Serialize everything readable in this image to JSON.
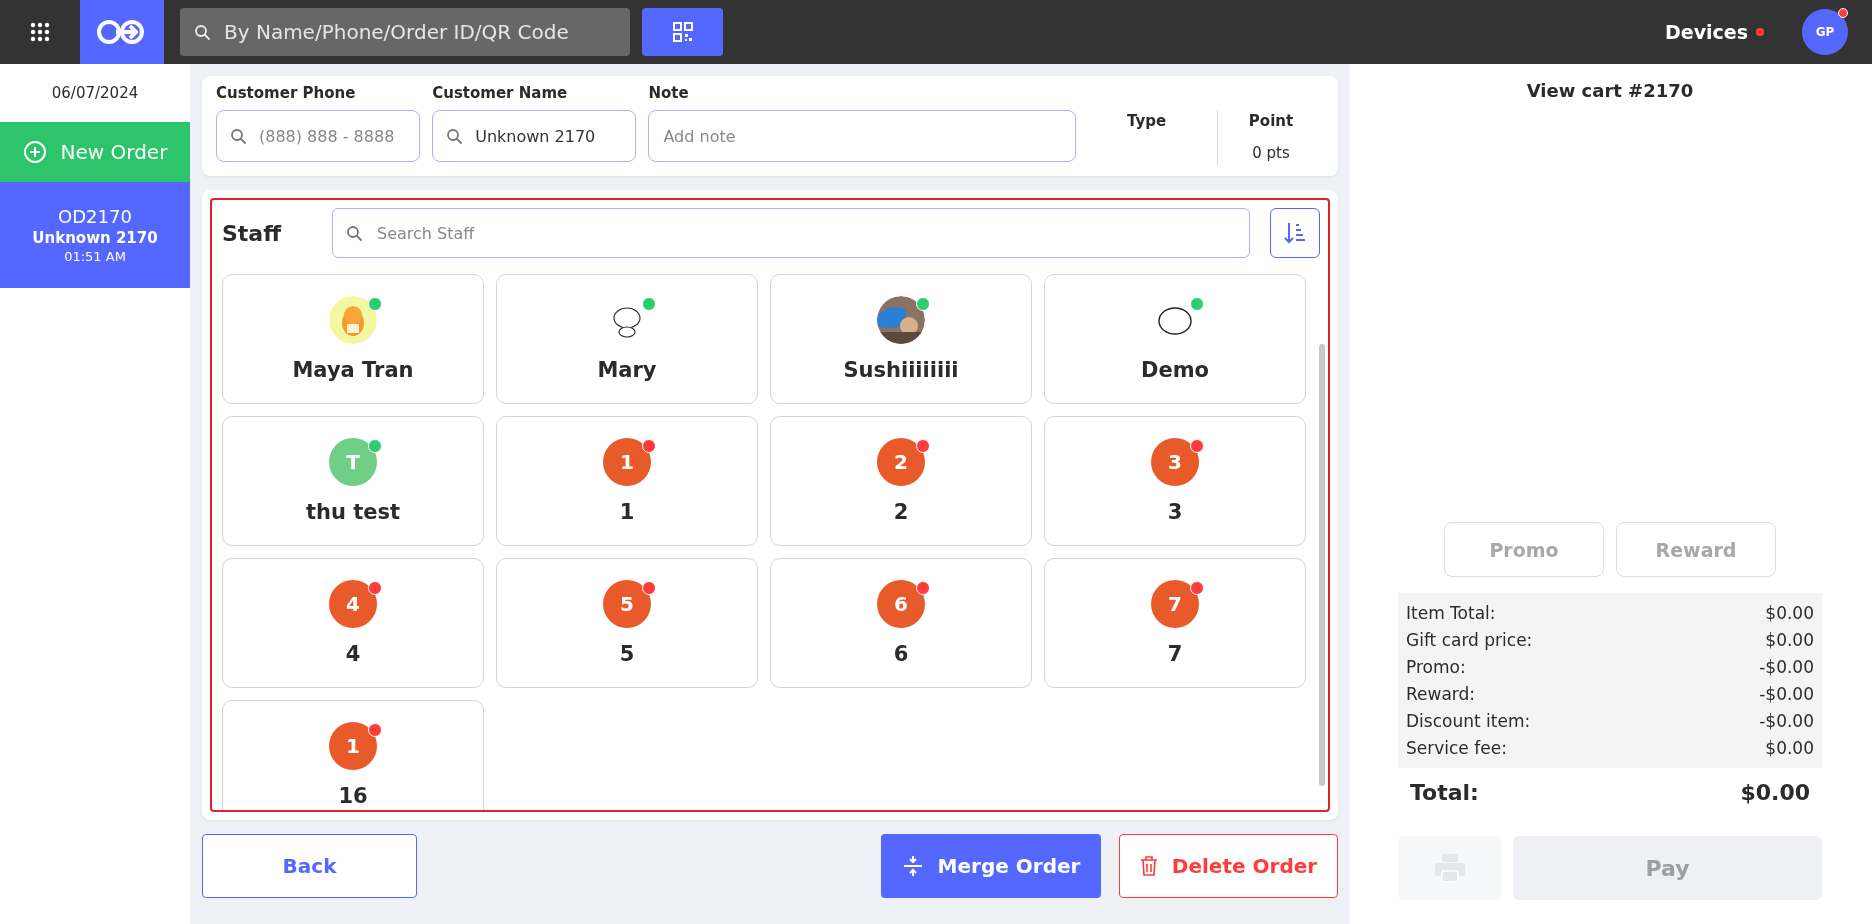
{
  "top_bar": {
    "search": {
      "placeholder": "By Name/Phone/Order ID/QR Code"
    },
    "devices": {
      "label": "Devices",
      "alert": true
    },
    "user": {
      "initials": "GP",
      "alert": true
    }
  },
  "sidebar": {
    "date": "06/07/2024",
    "new_order": "New Order",
    "orders": [
      {
        "id": "OD2170",
        "customer": "Unknown 2170",
        "time": "01:51 AM",
        "selected": true
      }
    ]
  },
  "customer": {
    "phone": {
      "label": "Customer Phone",
      "placeholder": "(888) 888 - 8888"
    },
    "name": {
      "label": "Customer Name",
      "value": "Unknown 2170"
    },
    "note": {
      "label": "Note",
      "placeholder": "Add note"
    },
    "type": {
      "label": "Type"
    },
    "point": {
      "label": "Point",
      "value": "0 pts"
    }
  },
  "staff": {
    "title": "Staff",
    "search": {
      "placeholder": "Search Staff"
    },
    "members": [
      {
        "name": "Maya Tran",
        "color": "#2ecc71"
      },
      {
        "name": "Mary",
        "color": "#2ecc71"
      },
      {
        "name": "Sushiiiiiiii",
        "color": "#2ecc71"
      },
      {
        "name": "Demo",
        "color": "#2ecc71"
      },
      {
        "name": "thu test",
        "avatar": {
          "kind": "letter",
          "text": "T"
        },
        "color": "#2ecc71"
      },
      {
        "name": "1",
        "avatar": {
          "kind": "number",
          "text": "1"
        },
        "color": "#ff3b3b"
      },
      {
        "name": "2",
        "avatar": {
          "kind": "number",
          "text": "2"
        },
        "color": "#ff3b3b"
      },
      {
        "name": "3",
        "avatar": {
          "kind": "number",
          "text": "3"
        },
        "color": "#ff3b3b"
      },
      {
        "name": "4",
        "avatar": {
          "kind": "number",
          "text": "4"
        },
        "color": "#ff3b3b"
      },
      {
        "name": "5",
        "avatar": {
          "kind": "number",
          "text": "5"
        },
        "color": "#ff3b3b"
      },
      {
        "name": "6",
        "avatar": {
          "kind": "number",
          "text": "6"
        },
        "color": "#ff3b3b"
      },
      {
        "name": "7",
        "avatar": {
          "kind": "number",
          "text": "7"
        },
        "color": "#ff3b3b"
      },
      {
        "name": "16",
        "avatar": {
          "kind": "number",
          "text": "1"
        },
        "color": "#ff3b3b"
      }
    ]
  },
  "actions": {
    "back": "Back",
    "merge": "Merge Order",
    "delete": "Delete Order"
  },
  "cart": {
    "title": "View cart #2170",
    "buttons": [
      {
        "label": "Promo",
        "disabled": true
      },
      {
        "label": "Reward",
        "disabled": true
      }
    ],
    "summary": [
      {
        "label": "Item Total:",
        "value": "$0.00"
      },
      {
        "label": "Gift card price:",
        "value": "$0.00"
      },
      {
        "label": "Promo:",
        "value": "-$0.00"
      },
      {
        "label": "Reward:",
        "value": "-$0.00"
      },
      {
        "label": "Discount item:",
        "value": "-$0.00"
      },
      {
        "label": "Service fee:",
        "value": "$0.00"
      }
    ],
    "total": {
      "label": "Total:",
      "value": "$0.00"
    },
    "print_disabled": true,
    "pay": {
      "label": "Pay",
      "disabled": true
    }
  }
}
